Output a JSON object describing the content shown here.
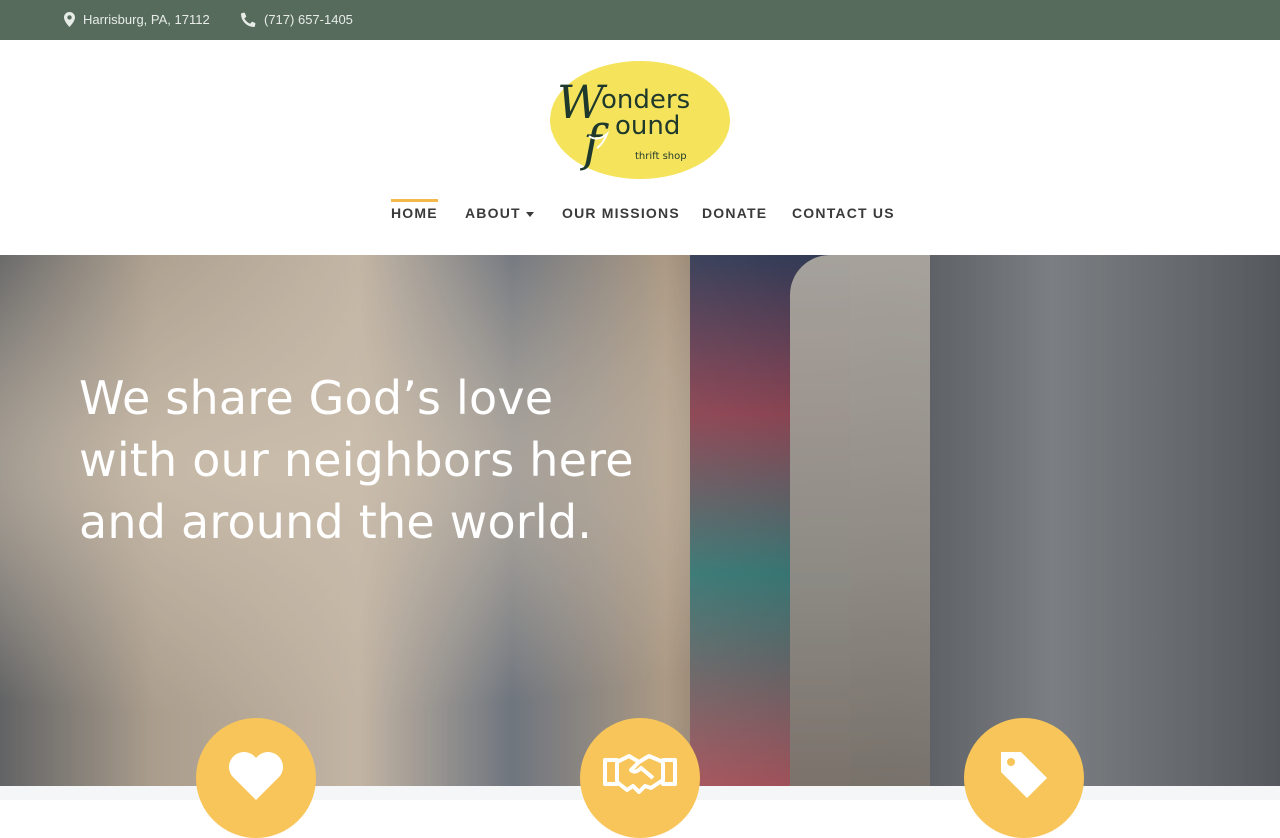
{
  "topbar": {
    "location": "Harrisburg, PA, 17112",
    "phone": "(717) 657-1405"
  },
  "logo": {
    "line1": "Wonders",
    "line2": "ound",
    "tagline": "thrift shop"
  },
  "nav": {
    "home": "HOME",
    "about": "ABOUT",
    "missions": "OUR MISSIONS",
    "donate": "DONATE",
    "contact": "CONTACT US",
    "active": "HOME"
  },
  "hero": {
    "line1": "We share God’s love",
    "line2": "with our neighbors here",
    "line3": "and around the world."
  },
  "features": [
    {
      "icon": "heart-icon"
    },
    {
      "icon": "handshake-icon"
    },
    {
      "icon": "tag-icon"
    }
  ],
  "colors": {
    "topbar": "#566b5c",
    "accent": "#f3b94a",
    "feature_circle": "#f8c55a",
    "logo_oval": "#f5e35c"
  }
}
